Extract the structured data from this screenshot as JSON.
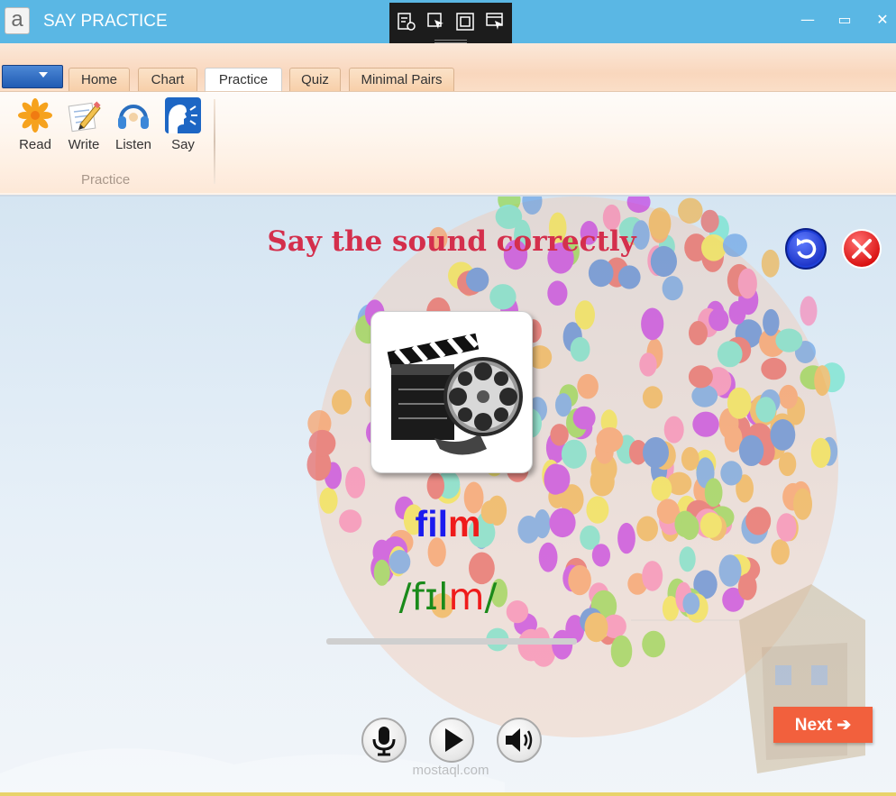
{
  "window": {
    "title": "SAY PRACTICE",
    "logo_letter": "a",
    "minimize_glyph": "—",
    "maximize_glyph": "▭",
    "close_glyph": "✕"
  },
  "capture_toolbar": {
    "icons": [
      "settings-capture-icon",
      "select-cursor-icon",
      "fullscreen-capture-icon",
      "window-capture-icon"
    ]
  },
  "ribbon": {
    "tabs": [
      {
        "label": "Home",
        "active": false
      },
      {
        "label": "Chart",
        "active": false
      },
      {
        "label": "Practice",
        "active": true
      },
      {
        "label": "Quiz",
        "active": false
      },
      {
        "label": "Minimal Pairs",
        "active": false
      }
    ],
    "buttons": [
      {
        "label": "Read",
        "icon": "flower-read-icon"
      },
      {
        "label": "Write",
        "icon": "pencil-write-icon"
      },
      {
        "label": "Listen",
        "icon": "headphones-icon"
      },
      {
        "label": "Say",
        "icon": "speaking-face-icon"
      }
    ],
    "group_label": "Practice"
  },
  "main": {
    "heading": "Say the sound correctly",
    "word": {
      "part1": "fil",
      "part2": "m"
    },
    "ipa": {
      "open": "/fɪl",
      "highlight": "m",
      "close": "/"
    },
    "progress_fraction": 0,
    "next_label": "Next",
    "watermark": "mostaql.com",
    "image_icon": "film-clapperboard-reel-icon",
    "control_icons": [
      "microphone-icon",
      "play-icon",
      "speaker-icon"
    ],
    "colors": {
      "heading": "#d42f4c",
      "word_main": "#1b1bef",
      "word_highlight": "#ef1b1b",
      "ipa_main": "#1a8a1a",
      "next_button": "#f2603d",
      "titlebar": "#5ab7e4"
    }
  }
}
